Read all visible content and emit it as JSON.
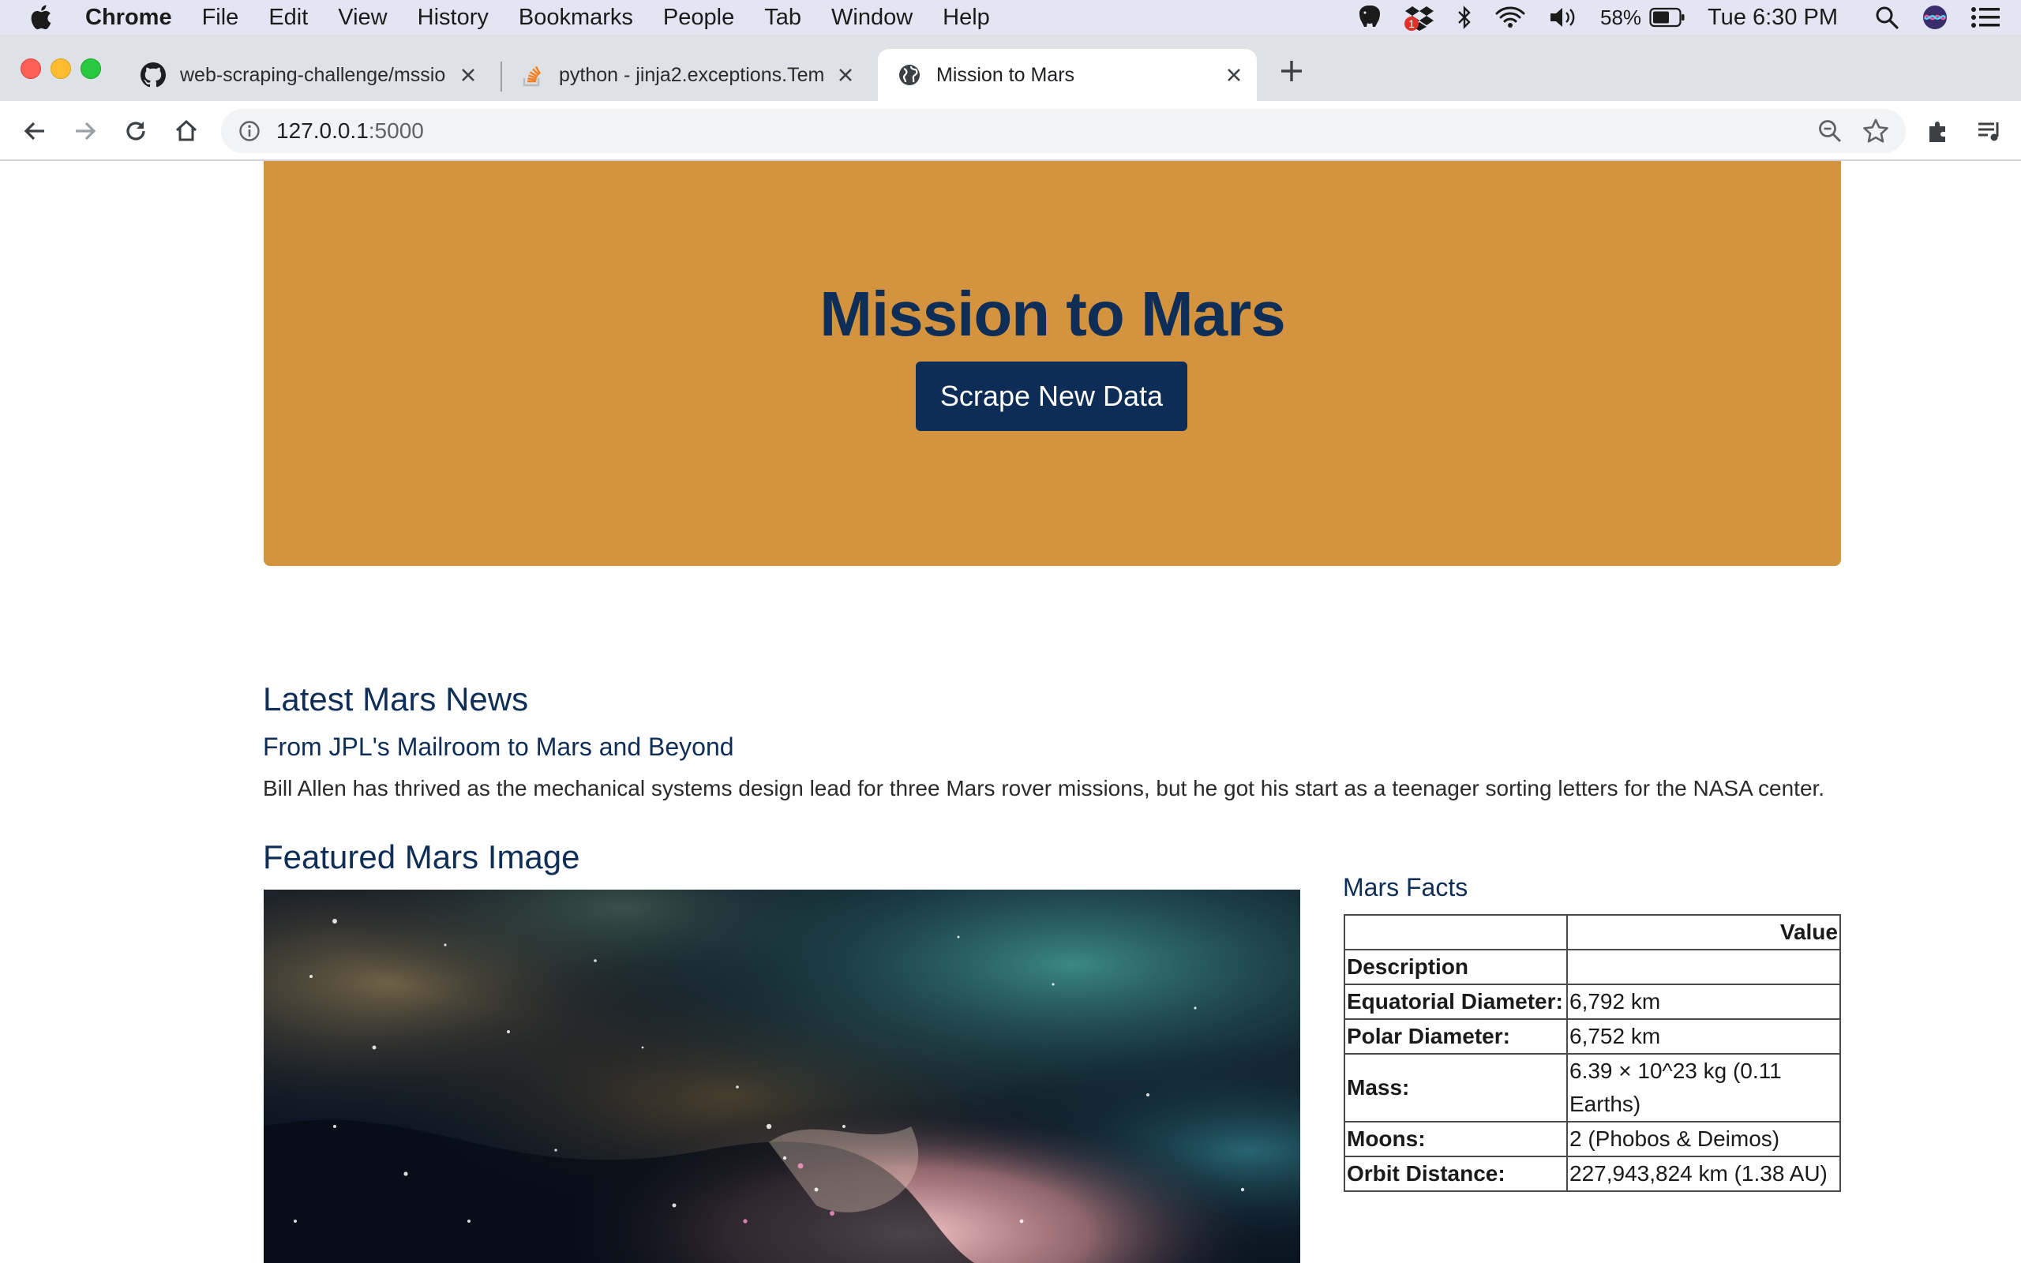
{
  "menubar": {
    "app_name": "Chrome",
    "items": [
      "File",
      "Edit",
      "View",
      "History",
      "Bookmarks",
      "People",
      "Tab",
      "Window",
      "Help"
    ],
    "battery": "58%",
    "clock": "Tue 6:30 PM",
    "dropbox_badge": "1"
  },
  "tabs": [
    {
      "title": "web-scraping-challenge/mssio",
      "icon": "github-icon",
      "active": false
    },
    {
      "title": "python - jinja2.exceptions.Tem",
      "icon": "stackoverflow-icon",
      "active": false
    },
    {
      "title": "Mission to Mars",
      "icon": "globe-icon",
      "active": true
    }
  ],
  "address_bar": {
    "host": "127.0.0.1",
    "port": ":5000"
  },
  "jumbotron": {
    "title": "Mission to Mars",
    "button_label": "Scrape New Data",
    "background": "#d4943f",
    "text_color": "#0e2d57"
  },
  "news": {
    "heading": "Latest Mars News",
    "title": "From JPL's Mailroom to Mars and Beyond",
    "paragraph": "Bill Allen has thrived as the mechanical systems design lead for three Mars rover missions, but he got his start as a teenager sorting letters for the NASA center."
  },
  "featured": {
    "heading": "Featured Mars Image"
  },
  "facts": {
    "heading": "Mars Facts",
    "header_value": "Value",
    "header_description": "Description",
    "rows": [
      {
        "label": "Equatorial Diameter:",
        "value": "6,792 km"
      },
      {
        "label": "Polar Diameter:",
        "value": "6,752 km"
      },
      {
        "label": "Mass:",
        "value": "6.39 × 10^23 kg (0.11 Earths)"
      },
      {
        "label": "Moons:",
        "value": "2 (Phobos & Deimos)"
      },
      {
        "label": "Orbit Distance:",
        "value": "227,943,824 km (1.38 AU)"
      }
    ]
  }
}
